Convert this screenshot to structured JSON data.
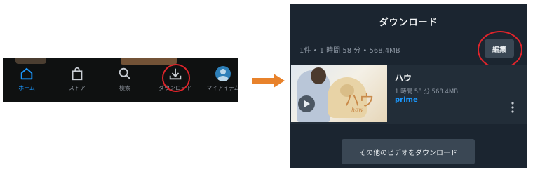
{
  "nav": {
    "items": [
      {
        "label": "ホーム",
        "icon": "home-icon"
      },
      {
        "label": "ストア",
        "icon": "shopping-bag-icon"
      },
      {
        "label": "検索",
        "icon": "search-icon"
      },
      {
        "label": "ダウンロード",
        "icon": "download-icon"
      },
      {
        "label": "マイアイテム",
        "icon": "profile-avatar-icon"
      }
    ]
  },
  "download": {
    "title": "ダウンロード",
    "summary": "1件 • 1 時間 58 分 • 568.4MB",
    "edit_label": "編集",
    "item": {
      "title": "ハウ",
      "meta": "1 時間 58 分  568.4MB",
      "badge": "prime",
      "thumb_title": "ハウ",
      "thumb_subtitle": "how"
    },
    "more_button": "その他のビデオをダウンロード"
  },
  "colors": {
    "accent": "#1a98ff",
    "highlight": "#e0242b",
    "arrow": "#e8822b"
  }
}
